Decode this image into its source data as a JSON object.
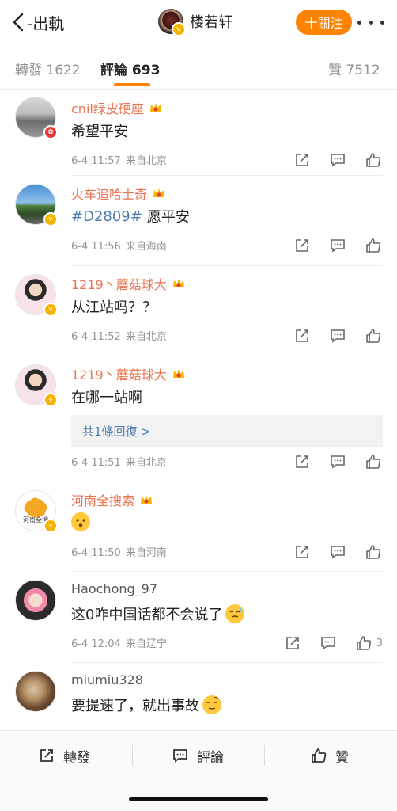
{
  "nav": {
    "back_label": "-出軌",
    "user_name": "楼若轩",
    "follow_label": "十關注"
  },
  "tabs": {
    "repost": "轉發 1622",
    "comment": "評論 693",
    "like": "贊 7512"
  },
  "comments": [
    {
      "user": "cnil绿皮硬座",
      "text": "希望平安",
      "time": "6-4 11:57",
      "source": "来自北京"
    },
    {
      "user": "火车追哈士奇",
      "tag": "#D2809#",
      "text": "愿平安",
      "time": "6-4 11:56",
      "source": "来自海南"
    },
    {
      "user": "1219丶蘑菇球大",
      "text": "从江站吗？？",
      "time": "6-4 11:52",
      "source": "来自北京"
    },
    {
      "user": "1219丶蘑菇球大",
      "text": "在哪一站啊",
      "reply": "共1條回復 >",
      "time": "6-4 11:51",
      "source": "来自北京"
    },
    {
      "user": "河南全搜索",
      "avatar_text": "河南全搜",
      "time": "6-4 11:50",
      "source": "来自河南"
    },
    {
      "user": "Haochong_97",
      "text": "这0咋中国话都不会说了",
      "time": "6-4 12:04",
      "source": "来自辽宁",
      "likes": "3"
    },
    {
      "user": "miumiu328",
      "text": "要提速了，就出事故"
    }
  ],
  "bottom": {
    "repost": "轉發",
    "comment": "評論",
    "like": "贊"
  },
  "colors": {
    "accent": "#ff8200",
    "username": "#eb7350",
    "link": "#507daf"
  }
}
